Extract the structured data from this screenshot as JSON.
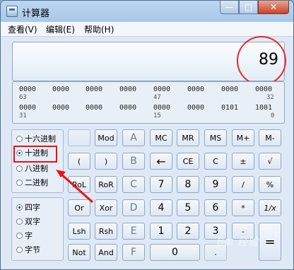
{
  "window": {
    "title": "计算器",
    "minimize": "—",
    "maximize": "□",
    "close": "✕"
  },
  "menu": [
    "查看(V)",
    "编辑(E)",
    "帮助(H)"
  ],
  "display": {
    "value": "89"
  },
  "bits": {
    "row1": [
      "0000",
      "0000",
      "0000",
      "0000",
      "0000",
      "0000",
      "0000",
      "0000"
    ],
    "row1_positions": {
      "left": "63",
      "mid": "47",
      "right": "32"
    },
    "row2": [
      "0000",
      "0000",
      "0000",
      "0000",
      "0000",
      "0000",
      "0101",
      "1001"
    ],
    "row2_positions": {
      "left": "31",
      "mid": "15",
      "right": "0"
    }
  },
  "radix": {
    "options": [
      "十六进制",
      "十进制",
      "八进制",
      "二进制"
    ],
    "selected": "十进制"
  },
  "word": {
    "options": [
      "四字",
      "双字",
      "字",
      "字节"
    ],
    "selected": "四字"
  },
  "keys": {
    "col1": [
      "",
      "(",
      "RoL",
      "Or",
      "Lsh",
      "Not"
    ],
    "col2": [
      "Mod",
      ")",
      "RoR",
      "Xor",
      "Rsh",
      "And"
    ],
    "col3": [
      "A",
      "B",
      "C",
      "D",
      "E",
      "F"
    ],
    "row1": [
      "MC",
      "MR",
      "MS",
      "M+",
      "M-"
    ],
    "row2": [
      "←",
      "CE",
      "C",
      "±",
      "√"
    ],
    "row3": [
      "7",
      "8",
      "9",
      "/",
      "%"
    ],
    "row4": [
      "4",
      "5",
      "6",
      "*",
      "1/x"
    ],
    "row5": [
      "1",
      "2",
      "3",
      "-",
      "="
    ],
    "row6": [
      "0",
      "."
    ]
  },
  "watermark": "Bai 经验"
}
